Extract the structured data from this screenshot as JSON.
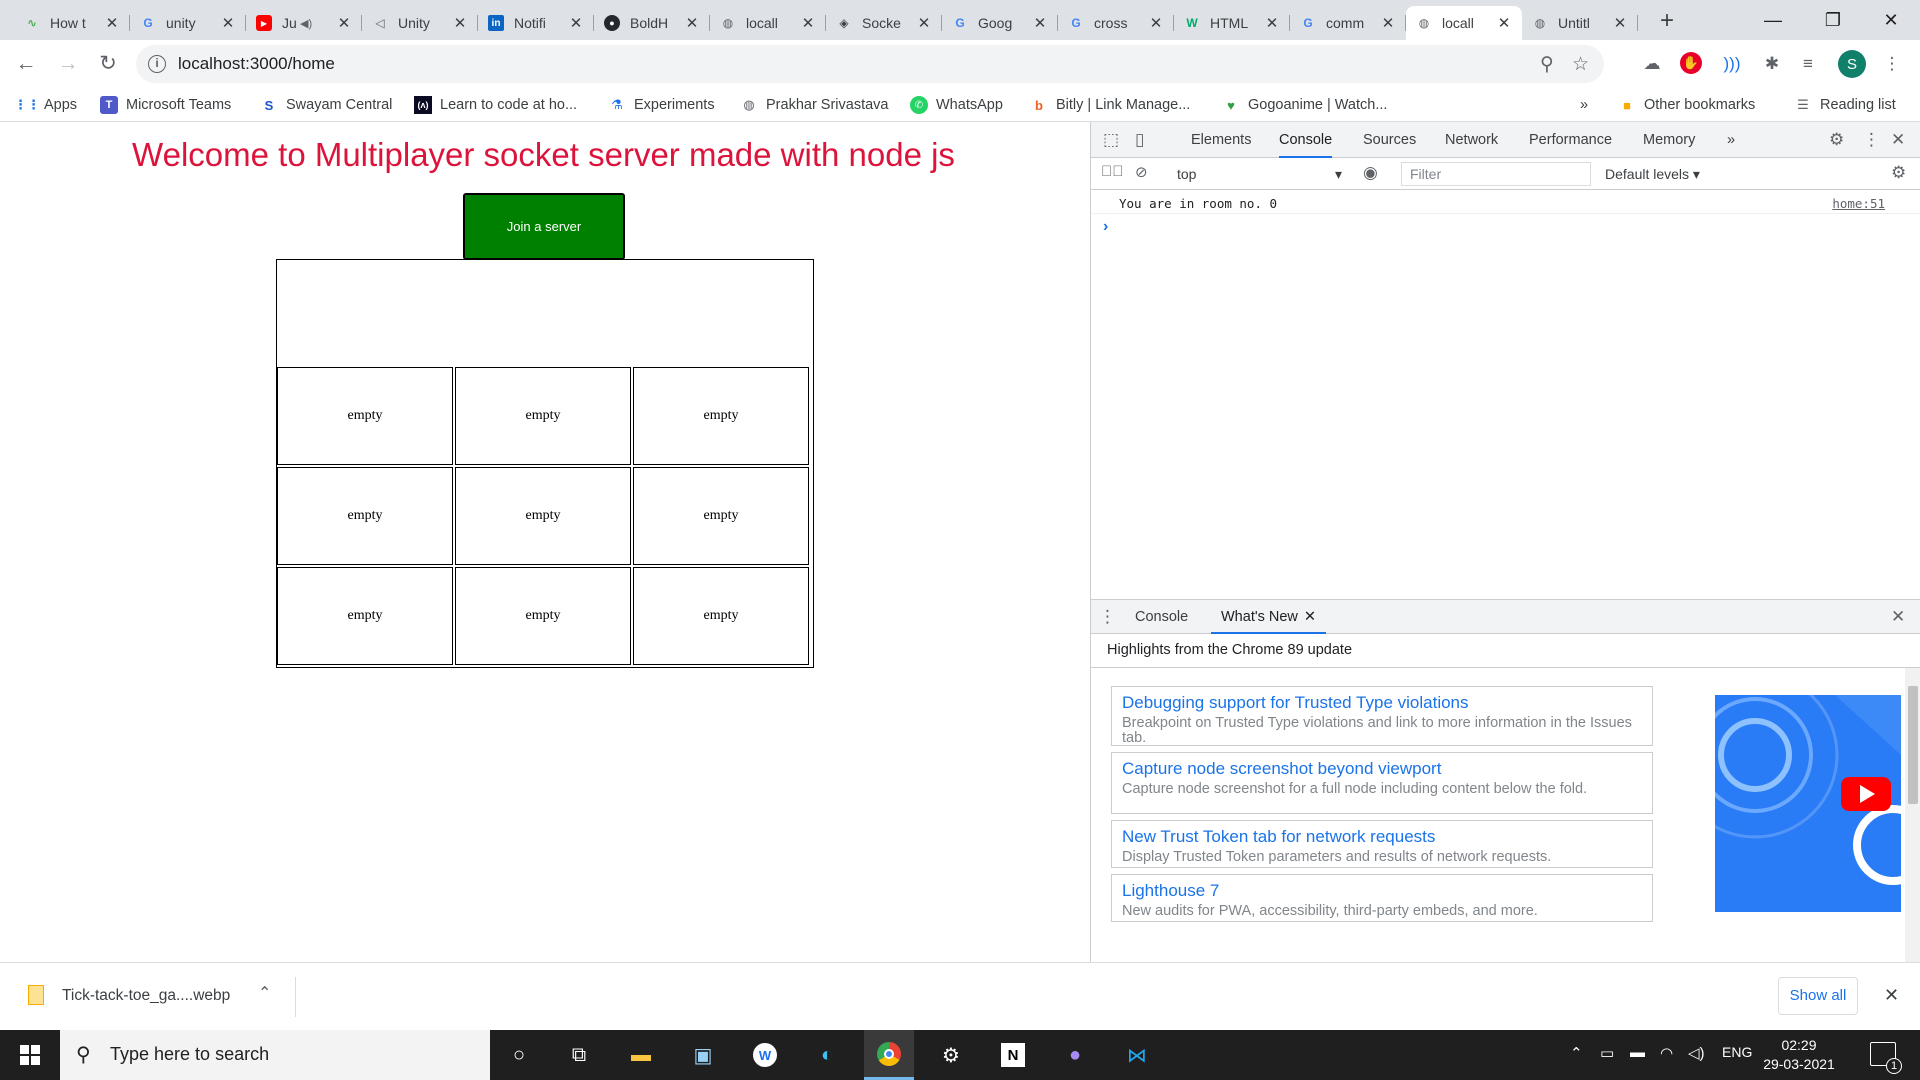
{
  "browser": {
    "tabs": [
      {
        "title": "How t",
        "icon": "caret-icon",
        "active": false
      },
      {
        "title": "unity",
        "icon": "google-icon",
        "active": false
      },
      {
        "title": "Ju",
        "icon": "youtube-icon",
        "active": false,
        "audio": true
      },
      {
        "title": "Unity",
        "icon": "unity-icon",
        "active": false
      },
      {
        "title": "Notifi",
        "icon": "linkedin-icon",
        "active": false
      },
      {
        "title": "BoldH",
        "icon": "github-icon",
        "active": false
      },
      {
        "title": "locall",
        "icon": "globe-icon",
        "active": false
      },
      {
        "title": "Socke",
        "icon": "socket-icon",
        "active": false
      },
      {
        "title": "Goog",
        "icon": "google-icon",
        "active": false
      },
      {
        "title": "cross",
        "icon": "google-icon",
        "active": false
      },
      {
        "title": "HTML",
        "icon": "w3schools-icon",
        "active": false
      },
      {
        "title": "comm",
        "icon": "google-icon",
        "active": false
      },
      {
        "title": "locall",
        "icon": "globe-icon",
        "active": true
      },
      {
        "title": "Untitl",
        "icon": "globe-icon",
        "active": false
      }
    ],
    "url": "localhost:3000/home",
    "profile_initial": "S",
    "bookmarks": [
      {
        "label": "Apps",
        "icon": "apps-grid-icon"
      },
      {
        "label": "Microsoft Teams",
        "icon": "teams-icon"
      },
      {
        "label": "Swayam Central",
        "icon": "swayam-icon"
      },
      {
        "label": "Learn to code at ho...",
        "icon": "fcc-icon"
      },
      {
        "label": "Experiments",
        "icon": "flask-icon"
      },
      {
        "label": "Prakhar Srivastava",
        "icon": "globe-icon"
      },
      {
        "label": "WhatsApp",
        "icon": "whatsapp-icon"
      },
      {
        "label": "Bitly | Link Manage...",
        "icon": "bitly-icon"
      },
      {
        "label": "Gogoanime | Watch...",
        "icon": "gogo-icon"
      }
    ],
    "more_bookmarks": "»",
    "other_bookmarks": "Other bookmarks",
    "reading_list": "Reading list"
  },
  "page": {
    "title": "Welcome to Multiplayer socket server made with node js",
    "join_button": "Join a server",
    "status_text": "",
    "cells": [
      "empty",
      "empty",
      "empty",
      "empty",
      "empty",
      "empty",
      "empty",
      "empty",
      "empty"
    ]
  },
  "devtools": {
    "tabs": [
      "Elements",
      "Console",
      "Sources",
      "Network",
      "Performance",
      "Memory"
    ],
    "active_tab": "Console",
    "more_tabs": "»",
    "context": "top",
    "filter_placeholder": "Filter",
    "levels": "Default levels ▾",
    "console_message": "You are in room no. 0",
    "console_source": "home:51",
    "prompt": "›",
    "drawer_tabs": [
      "Console",
      "What's New"
    ],
    "drawer_active": "What's New",
    "drawer_heading": "Highlights from the Chrome 89 update",
    "whats_new": [
      {
        "title": "Debugging support for Trusted Type violations",
        "desc": "Breakpoint on Trusted Type violations and link to more information in the Issues tab."
      },
      {
        "title": "Capture node screenshot beyond viewport",
        "desc": "Capture node screenshot for a full node including content below the fold."
      },
      {
        "title": "New Trust Token tab for network requests",
        "desc": "Display Trusted Token parameters and results of network requests."
      },
      {
        "title": "Lighthouse 7",
        "desc": "New audits for PWA, accessibility, third-party embeds, and more."
      }
    ]
  },
  "download": {
    "filename": "Tick-tack-toe_ga....webp",
    "show_all": "Show all"
  },
  "taskbar": {
    "search_placeholder": "Type here to search",
    "language": "ENG",
    "time": "02:29",
    "date": "29-03-2021",
    "notifications": "1"
  },
  "colors": {
    "title": "#dc143c",
    "join_button": "#008000",
    "accent": "#1a73e8"
  }
}
